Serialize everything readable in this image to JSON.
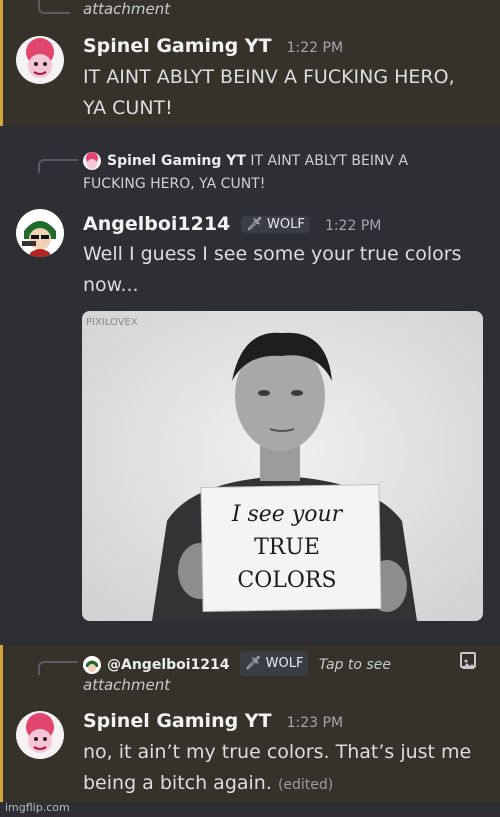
{
  "message1": {
    "reply_attachment_label": "attachment",
    "author": "Spinel Gaming YT",
    "time": "1:22 PM",
    "text": "IT AINT ABLYT BEINV A FUCKING HERO, YA CUNT!"
  },
  "message2": {
    "reply_author": "Spinel Gaming YT",
    "reply_text_line1": "IT AINT ABLYT BEINV A",
    "reply_text_line2": "FUCKING HERO, YA CUNT!",
    "author": "Angelboi1214",
    "badge": "WOLF",
    "time": "1:22 PM",
    "text_line1": "Well I guess I see some your  true colors",
    "text_line2": "now...",
    "image": {
      "corner_text": "PIXILOVEX",
      "sign_line1": "I see your",
      "sign_line2": "TRUE",
      "sign_line3": "COLORS"
    }
  },
  "message3": {
    "reply_author": "@Angelboi1214",
    "reply_badge": "WOLF",
    "reply_hint": "Tap to see",
    "reply_attachment_label": "attachment",
    "author": "Spinel Gaming YT",
    "time": "1:23 PM",
    "text_line1": "no, it ain’t my true colors. That’s just me",
    "text_line2": "being a bitch again.",
    "edited": "(edited)"
  },
  "watermark": "imgflip.com"
}
